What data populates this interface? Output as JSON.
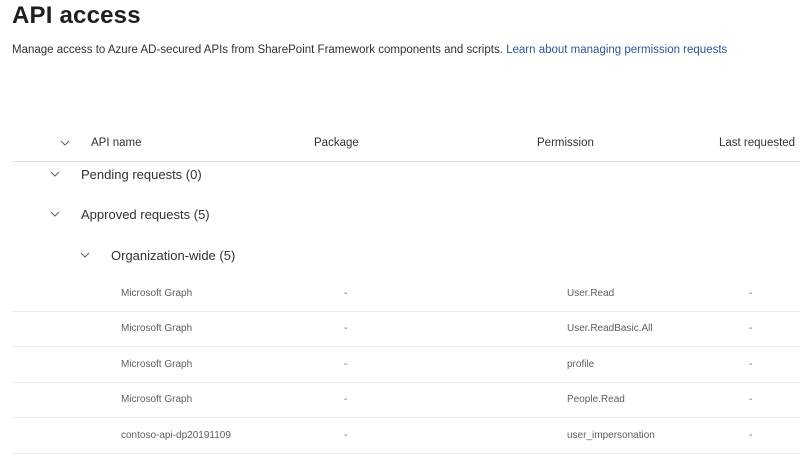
{
  "page": {
    "title": "API access",
    "description": "Manage access to Azure AD-secured APIs from SharePoint Framework components and scripts.",
    "learn_link": "Learn about managing permission requests"
  },
  "table": {
    "columns": {
      "api_name": "API name",
      "package": "Package",
      "permission": "Permission",
      "last_requested": "Last requested"
    },
    "groups": {
      "pending": "Pending requests (0)",
      "approved": "Approved requests (5)",
      "org_wide": "Organization-wide (5)"
    },
    "rows": [
      {
        "api": "Microsoft Graph",
        "package": "-",
        "permission": "User.Read",
        "last": "-"
      },
      {
        "api": "Microsoft Graph",
        "package": "-",
        "permission": "User.ReadBasic.All",
        "last": "-"
      },
      {
        "api": "Microsoft Graph",
        "package": "-",
        "permission": "profile",
        "last": "-"
      },
      {
        "api": "Microsoft Graph",
        "package": "-",
        "permission": "People.Read",
        "last": "-"
      },
      {
        "api": "contoso-api-dp20191109",
        "package": "-",
        "permission": "user_impersonation",
        "last": "-"
      }
    ]
  },
  "colors": {
    "link": "#2b5797",
    "text": "#323130",
    "muted": "#605e5c",
    "divider": "#edebe9"
  },
  "icons": [
    "chevron-down-icon"
  ]
}
